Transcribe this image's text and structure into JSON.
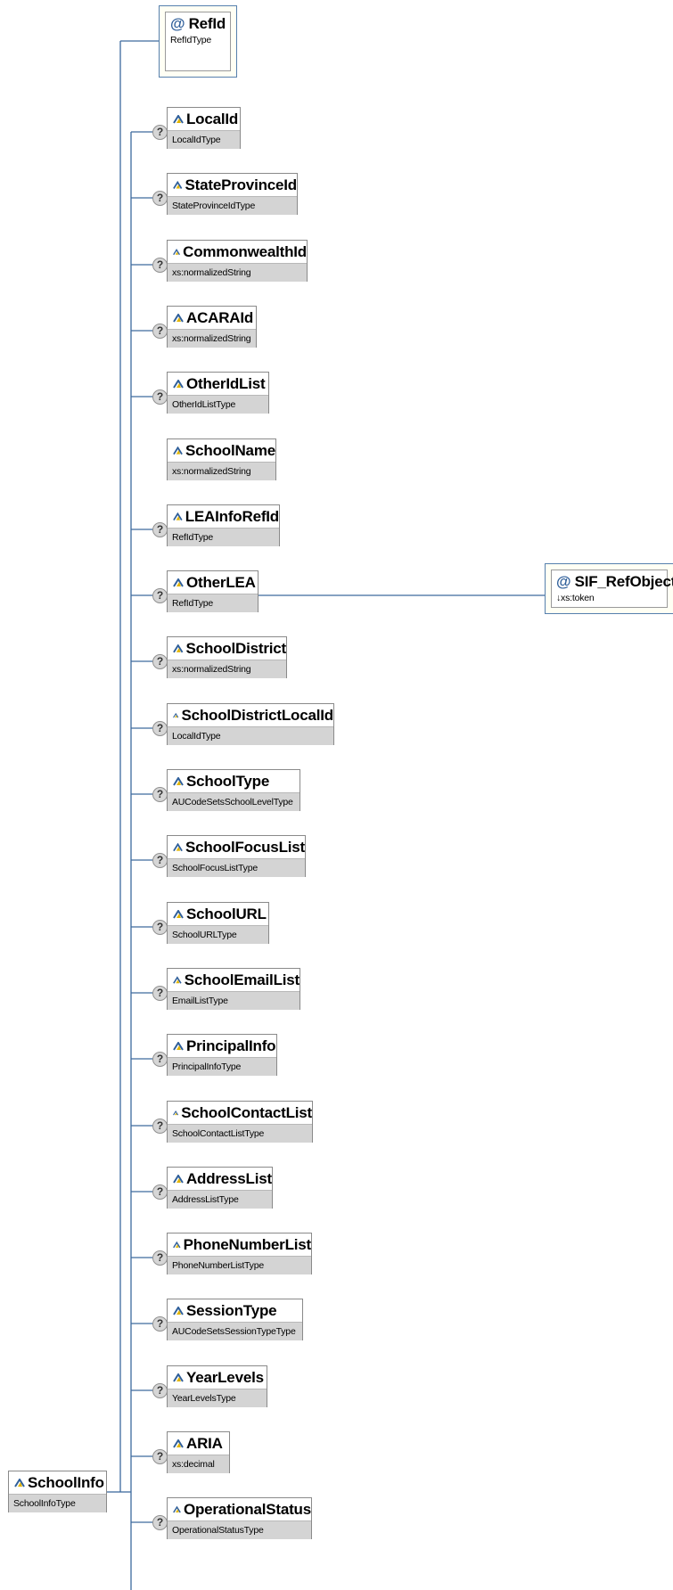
{
  "root": {
    "name": "SchoolInfo",
    "type": "SchoolInfoType"
  },
  "attributes": [
    {
      "name": "RefId",
      "type": "RefIdType"
    }
  ],
  "elements": [
    {
      "name": "LocalId",
      "type": "LocalIdType",
      "optional": true
    },
    {
      "name": "StateProvinceId",
      "type": "StateProvinceIdType",
      "optional": true
    },
    {
      "name": "CommonwealthId",
      "type": "xs:normalizedString",
      "optional": true
    },
    {
      "name": "ACARAId",
      "type": "xs:normalizedString",
      "optional": true
    },
    {
      "name": "OtherIdList",
      "type": "OtherIdListType",
      "optional": true
    },
    {
      "name": "SchoolName",
      "type": "xs:normalizedString",
      "optional": false
    },
    {
      "name": "LEAInfoRefId",
      "type": "RefIdType",
      "optional": true
    },
    {
      "name": "OtherLEA",
      "type": "RefIdType",
      "optional": true
    },
    {
      "name": "SchoolDistrict",
      "type": "xs:normalizedString",
      "optional": true
    },
    {
      "name": "SchoolDistrictLocalId",
      "type": "LocalIdType",
      "optional": true
    },
    {
      "name": "SchoolType",
      "type": "AUCodeSetsSchoolLevelType",
      "optional": true
    },
    {
      "name": "SchoolFocusList",
      "type": "SchoolFocusListType",
      "optional": true
    },
    {
      "name": "SchoolURL",
      "type": "SchoolURLType",
      "optional": true
    },
    {
      "name": "SchoolEmailList",
      "type": "EmailListType",
      "optional": true
    },
    {
      "name": "PrincipalInfo",
      "type": "PrincipalInfoType",
      "optional": true
    },
    {
      "name": "SchoolContactList",
      "type": "SchoolContactListType",
      "optional": true
    },
    {
      "name": "AddressList",
      "type": "AddressListType",
      "optional": true
    },
    {
      "name": "PhoneNumberList",
      "type": "PhoneNumberListType",
      "optional": true
    },
    {
      "name": "SessionType",
      "type": "AUCodeSetsSessionTypeType",
      "optional": true
    },
    {
      "name": "YearLevels",
      "type": "YearLevelsType",
      "optional": true
    },
    {
      "name": "ARIA",
      "type": "xs:decimal",
      "optional": true
    },
    {
      "name": "OperationalStatus",
      "type": "OperationalStatusType",
      "optional": true
    }
  ],
  "other_lea_attribute": {
    "name": "SIF_RefObject",
    "type": "↓xs:token"
  },
  "optional_badge_text": "?",
  "attribute_glyph": "@",
  "colors": {
    "connector": "#3d6a9e",
    "type_band": "#d4d4d4",
    "attr_border": "#5680ad",
    "attr_bg": "#fffff4"
  }
}
